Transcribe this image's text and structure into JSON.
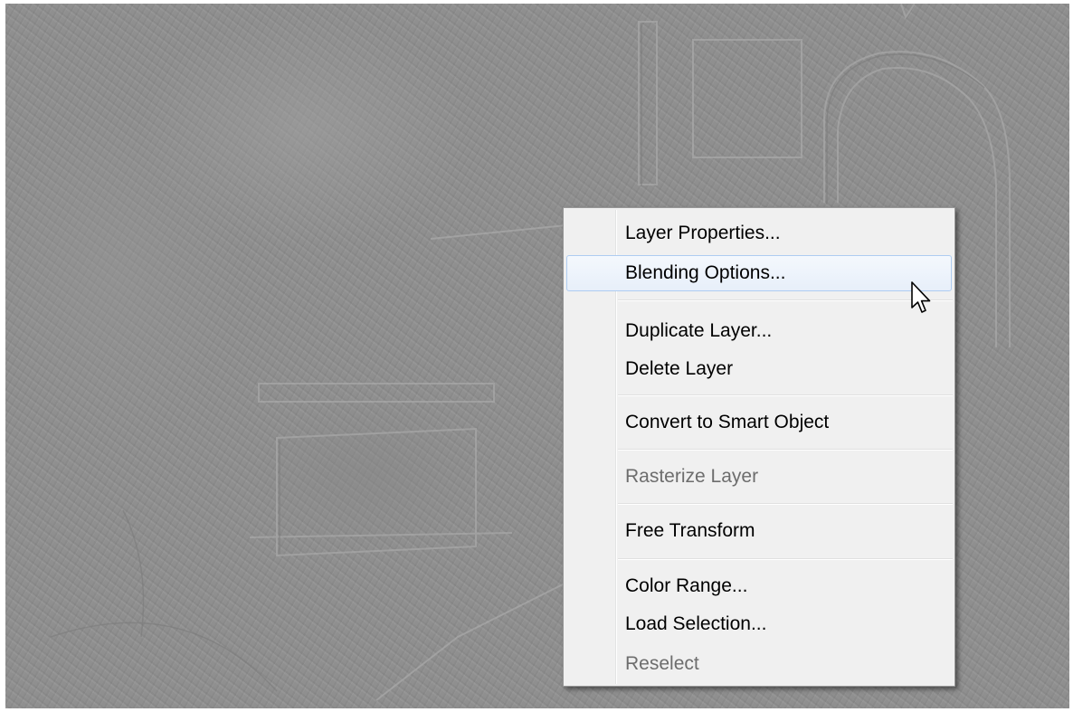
{
  "context_menu": {
    "items": [
      {
        "label": "Layer Properties...",
        "enabled": true
      },
      {
        "label": "Blending Options...",
        "enabled": true,
        "highlighted": true
      },
      {
        "label": "Duplicate Layer...",
        "enabled": true
      },
      {
        "label": "Delete Layer",
        "enabled": true
      },
      {
        "label": "Convert to Smart Object",
        "enabled": true
      },
      {
        "label": "Rasterize Layer",
        "enabled": false
      },
      {
        "label": "Free Transform",
        "enabled": true
      },
      {
        "label": "Color Range...",
        "enabled": true
      },
      {
        "label": "Load Selection...",
        "enabled": true
      },
      {
        "label": "Reselect",
        "enabled": false
      }
    ]
  },
  "cursor": {
    "icon": "arrow-pointer-icon"
  },
  "colors": {
    "canvas": "#8f8f8f",
    "menu_background": "#f0f0f0",
    "highlight_border": "#aeccf1",
    "disabled_text": "#6d6d6d"
  }
}
